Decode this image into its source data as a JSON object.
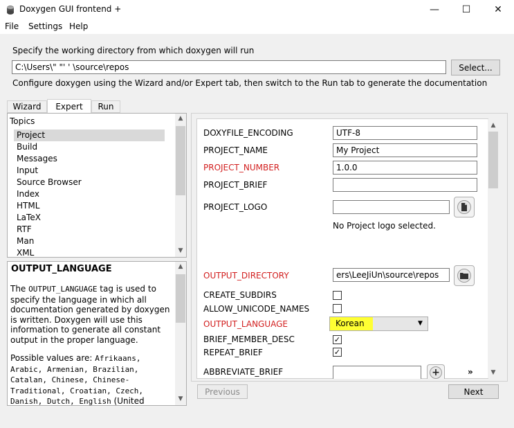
{
  "window": {
    "title": "Doxygen GUI frontend +",
    "minimize_glyph": "—",
    "maximize_glyph": "☐",
    "close_glyph": "✕"
  },
  "menu": [
    "File",
    "Settings",
    "Help"
  ],
  "workdir": {
    "prompt": "Specify the working directory from which doxygen will run",
    "value": "C:\\Users\\\"     \"' ' \\source\\repos",
    "select_label": "Select..."
  },
  "instructions": "Configure doxygen using the Wizard and/or Expert tab, then switch to the Run tab to generate the documentation",
  "tabs": [
    "Wizard",
    "Expert",
    "Run"
  ],
  "active_tab": "Expert",
  "topics": {
    "header": "Topics",
    "items": [
      "Project",
      "Build",
      "Messages",
      "Input",
      "Source Browser",
      "Index",
      "HTML",
      "LaTeX",
      "RTF",
      "Man",
      "XML"
    ],
    "selected": "Project"
  },
  "help": {
    "title": "OUTPUT_LANGUAGE",
    "p1_pre": "The ",
    "p1_code": "OUTPUT_LANGUAGE",
    "p1_post": " tag is used to specify the language in which all documentation generated by doxygen is written. Doxygen will use this information to generate all constant output in the proper language.",
    "p2_pre": "Possible values are: ",
    "p2_code": "Afrikaans, Arabic, Armenian, Brazilian, Catalan, Chinese, Chinese-Traditional, Croatian, Czech, Danish, Dutch, English",
    "p2_post": " (United"
  },
  "settings": {
    "doxyfile_encoding": {
      "label": "DOXYFILE_ENCODING",
      "value": "UTF-8"
    },
    "project_name": {
      "label": "PROJECT_NAME",
      "value": "My Project"
    },
    "project_number": {
      "label": "PROJECT_NUMBER",
      "value": "1.0.0"
    },
    "project_brief": {
      "label": "PROJECT_BRIEF",
      "value": ""
    },
    "project_logo": {
      "label": "PROJECT_LOGO",
      "value": "",
      "status": "No Project logo selected."
    },
    "output_directory": {
      "label": "OUTPUT_DIRECTORY",
      "value": "ers\\LeeJiUn\\source\\repos"
    },
    "create_subdirs": {
      "label": "CREATE_SUBDIRS",
      "checked": false
    },
    "allow_unicode_names": {
      "label": "ALLOW_UNICODE_NAMES",
      "checked": false
    },
    "output_language": {
      "label": "OUTPUT_LANGUAGE",
      "value": "Korean"
    },
    "brief_member_desc": {
      "label": "BRIEF_MEMBER_DESC",
      "checked": true
    },
    "repeat_brief": {
      "label": "REPEAT_BRIEF",
      "checked": true
    },
    "abbreviate_brief": {
      "label": "ABBREVIATE_BRIEF",
      "value": ""
    }
  },
  "nav": {
    "previous": "Previous",
    "next": "Next"
  },
  "colors": {
    "changed_option": "#d21e1e",
    "highlight": "#ffff33"
  }
}
